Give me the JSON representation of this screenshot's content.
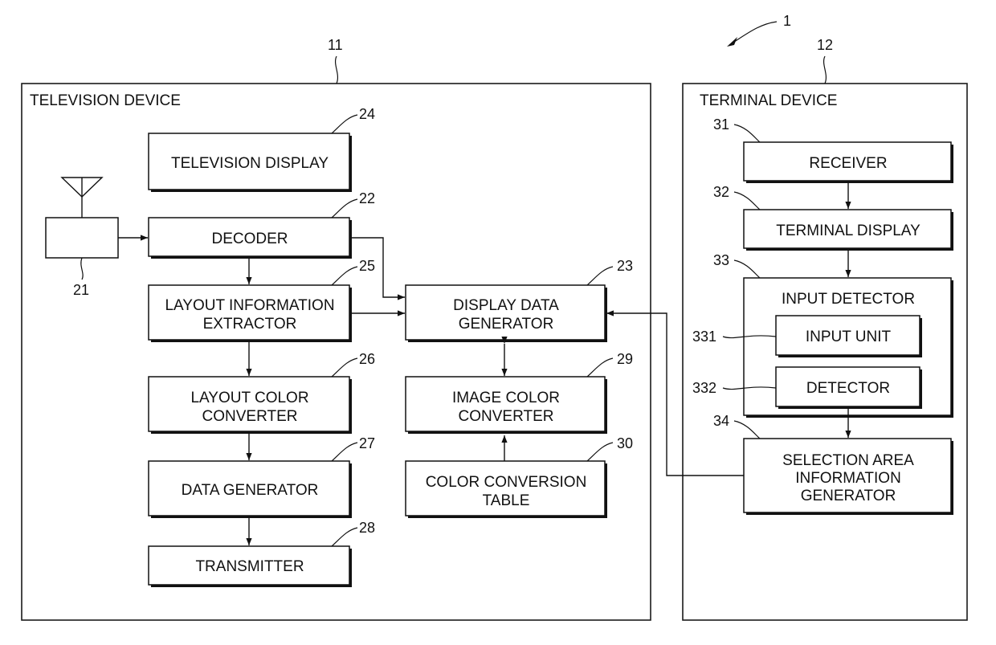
{
  "figure": {
    "system_ref": "1",
    "television_device": {
      "ref": "11",
      "title": "TELEVISION DEVICE",
      "blocks": {
        "television_display": {
          "ref": "24",
          "lines": [
            "TELEVISION DISPLAY"
          ]
        },
        "tuner": {
          "ref": "21",
          "lines": []
        },
        "decoder": {
          "ref": "22",
          "lines": [
            "DECODER"
          ]
        },
        "layout_information_extractor": {
          "ref": "25",
          "lines": [
            "LAYOUT INFORMATION",
            "EXTRACTOR"
          ]
        },
        "layout_color_converter": {
          "ref": "26",
          "lines": [
            "LAYOUT COLOR",
            "CONVERTER"
          ]
        },
        "data_generator": {
          "ref": "27",
          "lines": [
            "DATA GENERATOR"
          ]
        },
        "transmitter": {
          "ref": "28",
          "lines": [
            "TRANSMITTER"
          ]
        },
        "display_data_generator": {
          "ref": "23",
          "lines": [
            "DISPLAY DATA",
            "GENERATOR"
          ]
        },
        "image_color_converter": {
          "ref": "29",
          "lines": [
            "IMAGE COLOR",
            "CONVERTER"
          ]
        },
        "color_conversion_table": {
          "ref": "30",
          "lines": [
            "COLOR CONVERSION",
            "TABLE"
          ]
        }
      }
    },
    "terminal_device": {
      "ref": "12",
      "title": "TERMINAL DEVICE",
      "blocks": {
        "receiver": {
          "ref": "31",
          "lines": [
            "RECEIVER"
          ]
        },
        "terminal_display": {
          "ref": "32",
          "lines": [
            "TERMINAL DISPLAY"
          ]
        },
        "input_detector": {
          "ref": "33",
          "lines": [
            "INPUT DETECTOR"
          ]
        },
        "input_unit": {
          "ref": "331",
          "lines": [
            "INPUT UNIT"
          ]
        },
        "detector": {
          "ref": "332",
          "lines": [
            "DETECTOR"
          ]
        },
        "selection_area_information_generator": {
          "ref": "34",
          "lines": [
            "SELECTION AREA",
            "INFORMATION",
            "GENERATOR"
          ]
        }
      }
    }
  }
}
